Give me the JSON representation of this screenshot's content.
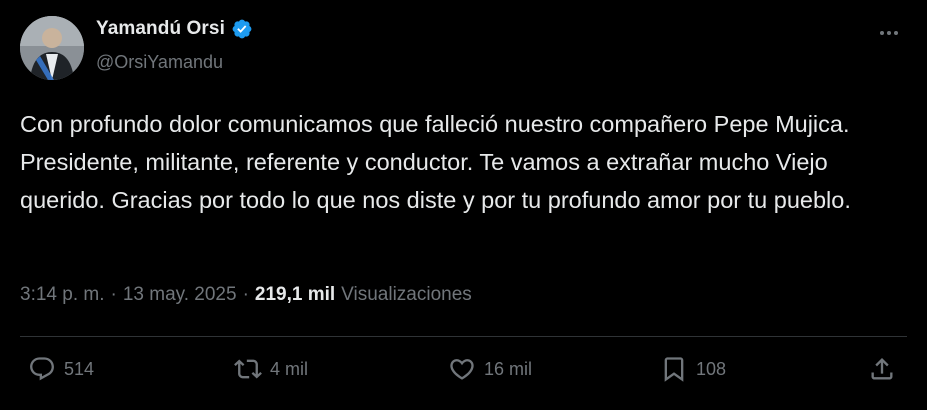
{
  "author": {
    "name": "Yamandú Orsi",
    "handle": "@OrsiYamandu",
    "verified_color": "#1d9bf0"
  },
  "tweet": {
    "text": "Con profundo dolor comunicamos que falleció nuestro compañero Pepe Mujica. Presidente, militante, referente y conductor. Te vamos a extrañar mucho Viejo querido. Gracias por todo lo que nos diste y por tu profundo amor por tu pueblo.",
    "time": "3:14 p. m.",
    "date": "13 may. 2025",
    "views_count": "219,1 mil",
    "views_label": "Visualizaciones"
  },
  "actions": {
    "replies": "514",
    "reposts": "4 mil",
    "likes": "16 mil",
    "bookmarks": "108"
  },
  "icons": [
    "verified-badge-icon",
    "more-options-icon",
    "reply-icon",
    "repost-icon",
    "like-icon",
    "bookmark-icon",
    "share-icon"
  ],
  "colors": {
    "background": "#000000",
    "text": "#e7e9ea",
    "secondary": "#71767b",
    "accent": "#1d9bf0",
    "divider": "#2f3336"
  }
}
